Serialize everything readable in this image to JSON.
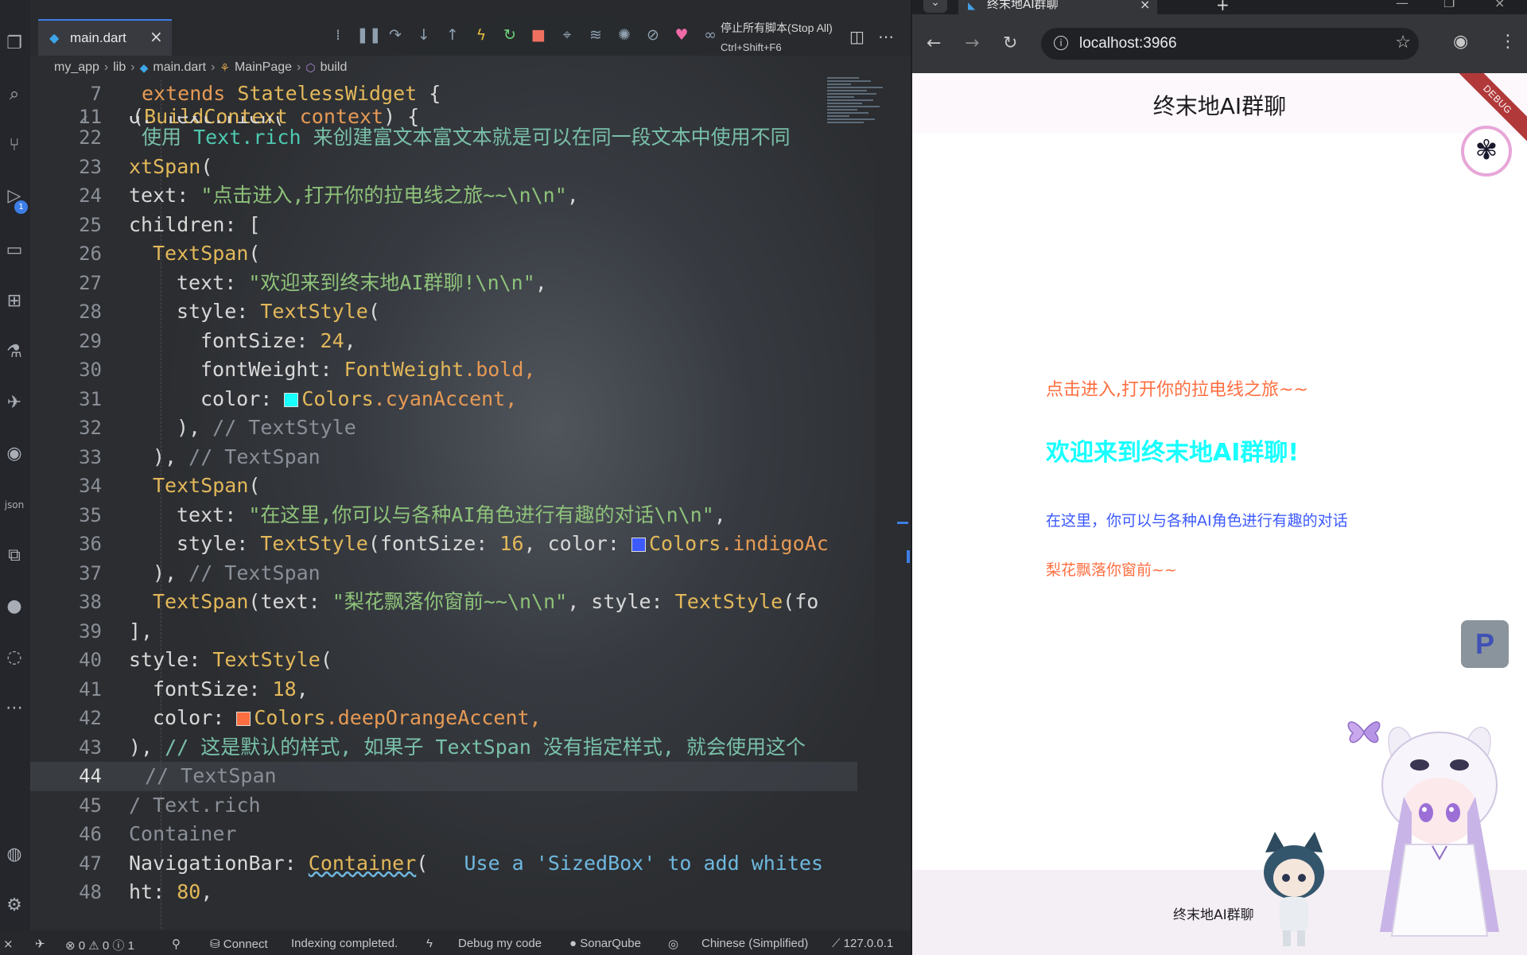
{
  "editor": {
    "tab": {
      "label": "main.dart"
    },
    "stop_all": {
      "label": "停止所有脚本(Stop All)",
      "shortcut": "Ctrl+Shift+F6"
    },
    "breadcrumb": [
      "my_app",
      "lib",
      "main.dart",
      "MainPage",
      "build"
    ],
    "line_numbers": [
      "7",
      "11",
      "21",
      "22",
      "23",
      "24",
      "25",
      "26",
      "27",
      "28",
      "29",
      "30",
      "31",
      "32",
      "33",
      "34",
      "35",
      "36",
      "37",
      "38",
      "39",
      "40",
      "41",
      "42",
      "43",
      "44",
      "45",
      "46",
      "47",
      "48"
    ],
    "code": {
      "l7a": "extends ",
      "l7b": "StatelessWidget",
      "l7c": " {",
      "l11a": "(",
      "l11b": "BuildContext",
      "l11c": " context",
      "l11d": ") {",
      "l21a": "d: Text.rich(",
      "l22a": "使用 ",
      "l22b": "Text.rich",
      "l22c": " 来创建富文本富文本就是可以在同一段文本中使用不同",
      "l23a": "xtSpan",
      "l23b": "(",
      "l24a": "text: ",
      "l24b": "\"点击进入,打开你的拉电线之旅~~\\n\\n\"",
      "l24c": ",",
      "l25a": "children: [",
      "l26a": "TextSpan",
      "l26b": "(",
      "l27a": "text: ",
      "l27b": "\"欢迎来到终末地AI群聊!\\n\\n\"",
      "l27c": ",",
      "l28a": "style: ",
      "l28b": "TextStyle",
      "l28c": "(",
      "l29a": "fontSize: ",
      "l29b": "24",
      "l29c": ",",
      "l30a": "fontWeight: ",
      "l30b": "FontWeight",
      "l30c": ".bold,",
      "l31a": "color: ",
      "l31b": "Colors",
      "l31c": ".cyanAccent,",
      "l32a": "), ",
      "l32b": "// TextStyle",
      "l33a": "), ",
      "l33b": "// TextSpan",
      "l34a": "TextSpan",
      "l34b": "(",
      "l35a": "text: ",
      "l35b": "\"在这里,你可以与各种AI角色进行有趣的对话\\n\\n\"",
      "l35c": ",",
      "l36a": "style: ",
      "l36b": "TextStyle",
      "l36c": "(fontSize: ",
      "l36d": "16",
      "l36e": ", color: ",
      "l36f": "Colors",
      "l36g": ".indigoAc",
      "l37a": "), ",
      "l37b": "// TextSpan",
      "l38a": "TextSpan",
      "l38b": "(text: ",
      "l38c": "\"梨花飘落你窗前~~\\n\\n\"",
      "l38d": ", style: ",
      "l38e": "TextStyle",
      "l38f": "(fo",
      "l39a": "],",
      "l40a": "style: ",
      "l40b": "TextStyle",
      "l40c": "(",
      "l41a": "fontSize: ",
      "l41b": "18",
      "l41c": ",",
      "l42a": "color: ",
      "l42b": "Colors",
      "l42c": ".deepOrangeAccent,",
      "l43a": "), ",
      "l43b": "// 这是默认的样式, 如果子 TextSpan 没有指定样式, 就会使用这个",
      "l44a": "// TextSpan",
      "l45a": "/ Text.rich",
      "l46a": "Container",
      "l47a": "NavigationBar: ",
      "l47b": "Container",
      "l47c": "(",
      "l47d": "   Use a 'SizedBox' to add whites",
      "l48a": "ht: ",
      "l48b": "80",
      "l48c": ","
    },
    "swatches": {
      "cyan": "#18ffff",
      "indigo": "#3d5afe",
      "deep_orange": "#ff6e40"
    },
    "status_bar": {
      "errors": "0",
      "warnings": "0",
      "info": "1",
      "connect": "Connect",
      "indexing": "Indexing completed.",
      "debug": "Debug my code",
      "sonar": "SonarQube",
      "language": "Chinese (Simplified)",
      "host": "127.0.0.1"
    },
    "accent": "#3d7ee6"
  },
  "browser": {
    "tab_title": "终末地AI群聊",
    "url": "localhost:3966",
    "app": {
      "title": "终末地AI群聊",
      "debug_banner": "DEBUG",
      "lines": {
        "default": "点击进入,打开你的拉电线之旅~~",
        "welcome": "欢迎来到终末地AI群聊!",
        "indigo": "在这里，你可以与各种AI角色进行有趣的对话",
        "last": "梨花飘落你窗前~~"
      },
      "p_button": "P",
      "nav_text": "终末地AI群聊",
      "colors": {
        "default": "#ff6e40",
        "welcome": "#18ffff",
        "indigo": "#3d5afe"
      }
    }
  }
}
